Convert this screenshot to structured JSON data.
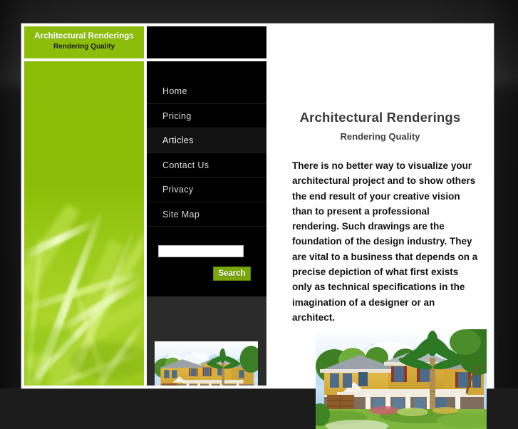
{
  "site": {
    "brand_title": "Architectural Renderings",
    "brand_subtitle": "Rendering Quality",
    "accent_green": "#8cbd0a",
    "button_green": "#7aa80b",
    "nav_background": "#000000",
    "page_background": "#ffffff"
  },
  "nav": {
    "items": [
      {
        "label": "Home",
        "active": false
      },
      {
        "label": "Pricing",
        "active": false
      },
      {
        "label": "Articles",
        "active": true
      },
      {
        "label": "Contact Us",
        "active": false
      },
      {
        "label": "Privacy",
        "active": false
      },
      {
        "label": "Site Map",
        "active": false
      }
    ]
  },
  "search": {
    "value": "",
    "placeholder": "",
    "button_label": "Search"
  },
  "main": {
    "title": "Architectural Renderings",
    "subtitle": "Rendering Quality",
    "paragraph": "There is no better way to visualize your architectural project and to show others the end result of your creative vision than to present a professional rendering.  Such drawings are the foundation of the design industry.  They are vital to a business that depends on a precise depiction of what first exists only as technical specifications in the imagination of a designer or an architect."
  },
  "images": {
    "sidebar_graphic": "green-grass-blades-graphic",
    "nav_thumbnail": "house-rendering-thumbnail",
    "main_photo": "house-rendering-illustration"
  }
}
